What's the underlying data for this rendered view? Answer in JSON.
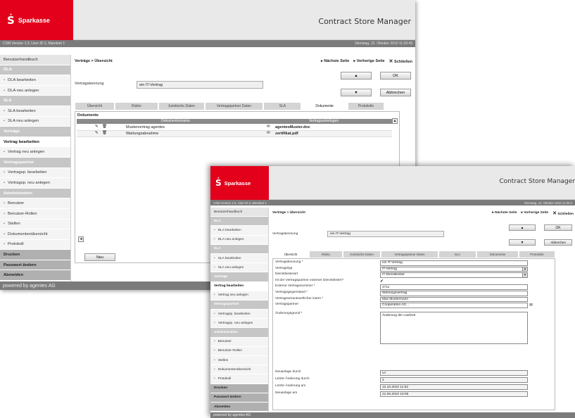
{
  "brand": {
    "name": "Sparkasse",
    "logo_glyph": "Ṡ",
    "color": "#e3001b"
  },
  "app": {
    "title": "Contract Store Manager",
    "title_clipped": "Contract Store Manager"
  },
  "w1": {
    "version": "CSM Version 1.0, User-ID 2, Mandant 1",
    "date": "Dienstag, 12. Oktober 2010 11:53:49",
    "sidebar": [
      {
        "label": "Benutzerhandbuch",
        "kind": "light"
      },
      {
        "label": "DLA",
        "kind": "sec"
      },
      {
        "label": "DLA bearbeiten",
        "kind": "item"
      },
      {
        "label": "DLA neu anlegen",
        "kind": "item"
      },
      {
        "label": "SLA",
        "kind": "sec"
      },
      {
        "label": "SLA bearbeiten",
        "kind": "item"
      },
      {
        "label": "SLA neu anlegen",
        "kind": "item"
      },
      {
        "label": "Verträge",
        "kind": "sec"
      },
      {
        "label": "Vertrag bearbeiten",
        "kind": "active"
      },
      {
        "label": "Vertrag neu anlegen",
        "kind": "item"
      },
      {
        "label": "Vertragspartner",
        "kind": "sec"
      },
      {
        "label": "Vertragsp. bearbeiten",
        "kind": "item"
      },
      {
        "label": "Vertragsp. neu anlegen",
        "kind": "item"
      },
      {
        "label": "Administration",
        "kind": "sec"
      },
      {
        "label": "Benutzer",
        "kind": "item"
      },
      {
        "label": "Benutzer-Rollen",
        "kind": "item"
      },
      {
        "label": "Stellen",
        "kind": "item"
      },
      {
        "label": "Dokumentenübersicht",
        "kind": "item"
      },
      {
        "label": "Protokoll",
        "kind": "item"
      },
      {
        "label": "Drucken",
        "kind": "dark"
      },
      {
        "label": "Passwort ändern",
        "kind": "dark"
      },
      {
        "label": "Abmelden",
        "kind": "dark"
      }
    ],
    "footer": "powered by agentes AG",
    "breadcrumb": "Verträge > Übersicht",
    "nav": {
      "next": "Nächste Seite",
      "prev": "Vorherige Seite",
      "close": "Schließen"
    },
    "buttons": {
      "ok": "OK",
      "cancel": "Abbrechen",
      "new": "Neu",
      "up": "▲",
      "down": "▼"
    },
    "field_label": "Vertragskennung",
    "field_value": "ein IT-Vertrag",
    "tabs": [
      "Übersicht",
      "Risiko",
      "Juristische Daten",
      "Vertragspartner Daten",
      "SLA",
      "Dokumente",
      "Protokolle"
    ],
    "active_tab": "Dokumente",
    "docs": {
      "section": "Dokumente",
      "col1": "Dokumentenname",
      "col2": "Vertragsunterlagen",
      "rows": [
        {
          "name": "Mustervertrag agentes",
          "file": "agentesMuster.doc"
        },
        {
          "name": "Wartungsabnahme",
          "file": "zertifikat.pdf"
        }
      ]
    }
  },
  "w2": {
    "version": "CSM Version 1.0, User-ID 2, Mandant 1",
    "date": "Dienstag, 12. Oktober 2010 11:32:2",
    "sidebar": [
      {
        "label": "Benutzerhandbuch",
        "kind": "light"
      },
      {
        "label": "DLA",
        "kind": "sec"
      },
      {
        "label": "DLA bearbeiten",
        "kind": "item"
      },
      {
        "label": "DLA neu anlegen",
        "kind": "item"
      },
      {
        "label": "SLA",
        "kind": "sec"
      },
      {
        "label": "SLA bearbeiten",
        "kind": "item"
      },
      {
        "label": "SLA neu anlegen",
        "kind": "item"
      },
      {
        "label": "Verträge",
        "kind": "sec"
      },
      {
        "label": "Vertrag bearbeiten",
        "kind": "active"
      },
      {
        "label": "Vertrag neu anlegen",
        "kind": "item"
      },
      {
        "label": "Vertragspartner",
        "kind": "sec"
      },
      {
        "label": "Vertragsp. bearbeiten",
        "kind": "item"
      },
      {
        "label": "Vertragsp. neu anlegen",
        "kind": "item"
      },
      {
        "label": "Administration",
        "kind": "sec"
      },
      {
        "label": "Benutzer",
        "kind": "item"
      },
      {
        "label": "Benutzer-Rollen",
        "kind": "item"
      },
      {
        "label": "Stellen",
        "kind": "item"
      },
      {
        "label": "Dokumentenübersicht",
        "kind": "item"
      },
      {
        "label": "Protokoll",
        "kind": "item"
      },
      {
        "label": "Drucken",
        "kind": "dark"
      },
      {
        "label": "Passwort ändern",
        "kind": "dark"
      },
      {
        "label": "Abmelden",
        "kind": "dark"
      }
    ],
    "footer": "powered by agentes AG",
    "breadcrumb": "Verträge > Übersicht",
    "nav": {
      "next": "Nächste Seite",
      "prev": "Vorherige Seite",
      "close": "Schließen"
    },
    "buttons": {
      "ok": "OK",
      "cancel": "Abbrechen",
      "up": "▲",
      "down": "▼"
    },
    "field_label": "Vertragskennung",
    "field_value": "ein IT-Vertrag",
    "tabs": [
      "Übersicht",
      "Risiko",
      "Juristische Daten",
      "Vertragspartner Daten",
      "SLA",
      "Dokumente",
      "Protokolle"
    ],
    "active_tab": "Übersicht",
    "form": [
      {
        "label": "Vertragskennung *",
        "value": "ein IT-Vertrag",
        "type": "text"
      },
      {
        "label": "Vertragstyp",
        "value": "IT-Vertrag",
        "type": "select"
      },
      {
        "label": "Dienstleisterart",
        "value": "IT-Dienstleister",
        "type": "select"
      },
      {
        "label": "Ist der Vertragspartner externer Dienstleister?",
        "value": "✔",
        "type": "check"
      },
      {
        "label": "Externe Vertragsnummer *",
        "value": "4711",
        "type": "text"
      },
      {
        "label": "Vertragsgegenstand *",
        "value": "Wartungsvertrag",
        "type": "text"
      },
      {
        "label": "Vertragsverantwortlicher intern *",
        "value": "Max Mustermann",
        "type": "text"
      },
      {
        "label": "Vertragspartner",
        "value": "Cooperation AG, .",
        "type": "pick"
      }
    ],
    "reason": {
      "label": "Änderungsgrund *",
      "value": "Änderung der Laufzeit"
    },
    "meta": [
      {
        "label": "Neuanlage durch",
        "value": "UI"
      },
      {
        "label": "Letzte Änderung durch",
        "value": "2"
      },
      {
        "label": "Letzte Änderung am",
        "value": "12.10.2010 11:52"
      },
      {
        "label": "Neuanlage am",
        "value": "21.06.2010 10:05"
      }
    ]
  }
}
